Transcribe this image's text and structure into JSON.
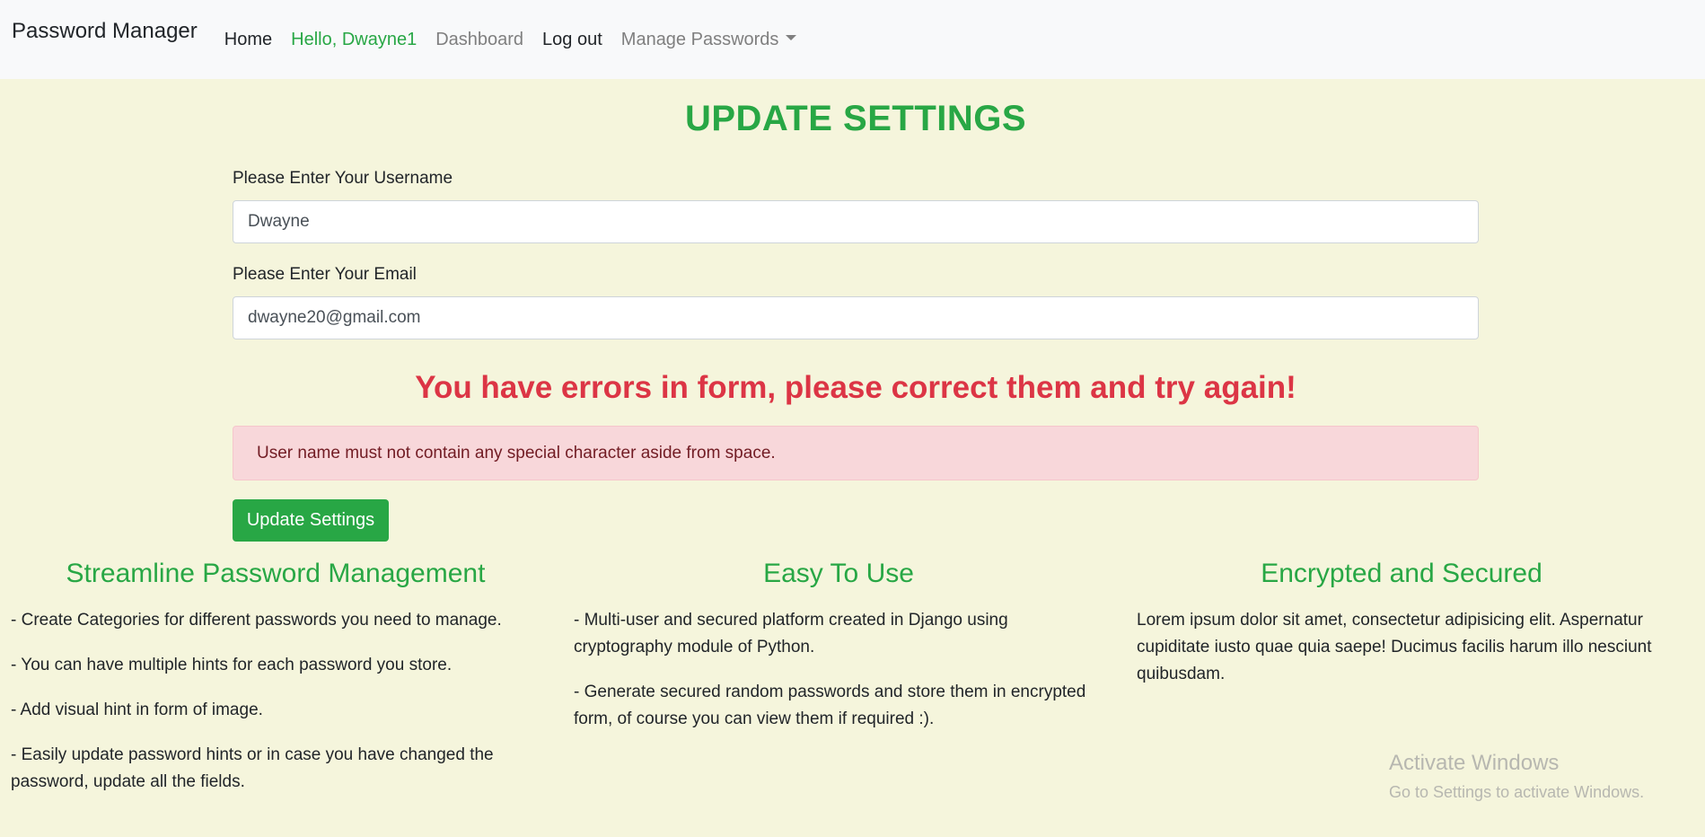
{
  "nav": {
    "brand": "Password Manager",
    "home": "Home",
    "greeting": "Hello, Dwayne1",
    "dashboard": "Dashboard",
    "logout": "Log out",
    "manage": "Manage Passwords"
  },
  "page": {
    "title": "UPDATE SETTINGS"
  },
  "form": {
    "username_label": "Please Enter Your Username",
    "username_value": "Dwayne",
    "email_label": "Please Enter Your Email",
    "email_value": "dwayne20@gmail.com",
    "error_heading": "You have errors in form, please correct them and try again!",
    "error_message": "User name must not contain any special character aside from space.",
    "submit_label": "Update Settings"
  },
  "features": [
    {
      "title": "Streamline Password Management",
      "items": [
        "- Create Categories for different passwords you need to manage.",
        "- You can have multiple hints for each password you store.",
        "- Add visual hint in form of image.",
        "- Easily update password hints or in case you have changed the password, update all the fields."
      ]
    },
    {
      "title": "Easy To Use",
      "items": [
        "- Multi-user and secured platform created in Django using cryptography module of Python.",
        "- Generate secured random passwords and store them in encrypted form, of course you can view them if required :)."
      ]
    },
    {
      "title": "Encrypted and Secured",
      "items": [
        "Lorem ipsum dolor sit amet, consectetur adipisicing elit. Aspernatur cupiditate iusto quae quia saepe! Ducimus facilis harum illo nesciunt quibusdam."
      ]
    }
  ],
  "watermark": {
    "line1": "Activate Windows",
    "line2": "Go to Settings to activate Windows."
  },
  "colors": {
    "accent": "#28a745",
    "danger": "#dc3545",
    "alert_bg": "#f8d7da",
    "page_bg": "#f5f5dc"
  }
}
